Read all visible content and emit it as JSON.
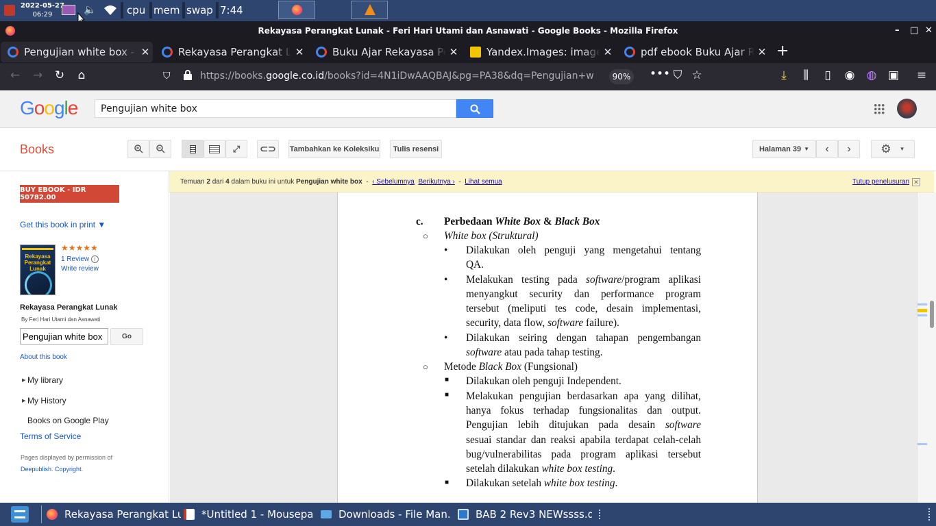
{
  "top_panel": {
    "date": "2022-05-27",
    "time_small": "06:29",
    "cpu": "cpu",
    "mem": "mem",
    "swap": "swap",
    "clock": "7:44"
  },
  "window": {
    "title": "Rekayasa Perangkat Lunak - Feri Hari Utami dan Asnawati - Google Books - Mozilla Firefox"
  },
  "tabs": [
    {
      "label": "Pengujian white box - P",
      "active": true
    },
    {
      "label": "Rekayasa Perangkat Lu",
      "active": false
    },
    {
      "label": "Buku Ajar Rekayasa Pe",
      "active": false
    },
    {
      "label": "Yandex.Images: image",
      "active": false
    },
    {
      "label": "pdf ebook Buku Ajar Re",
      "active": false
    }
  ],
  "navbar": {
    "url_prefix": "https://books.",
    "url_domain": "google.co.id",
    "url_rest": "/books?id=4N1iDwAAQBAJ&pg=PA38&dq=Pengujian+w",
    "zoom": "90%"
  },
  "google": {
    "search_value": "Pengujian white box"
  },
  "books_bar": {
    "books_label": "Books",
    "add_collection": "Tambahkan ke Koleksiku",
    "write_review": "Tulis resensi",
    "page_select": "Halaman 39"
  },
  "sidebar": {
    "buy_label": "BUY EBOOK - IDR 50782.00",
    "get_print": "Get this book in print ▼",
    "stars": "★★★★★",
    "reviews": "1 Review",
    "write_review": "Write review",
    "cover_title": "Rekayasa Perangkat Lunak",
    "book_title": "Rekayasa Perangkat Lunak",
    "authors": "By Feri Hari Utami dan Asnawati",
    "search_value": "Pengujian white box",
    "go": "Go",
    "about": "About this book",
    "my_library": "My library",
    "my_history": "My History",
    "books_on_play": "Books on Google Play",
    "terms": "Terms of Service",
    "perm_text": "Pages displayed by permission of",
    "publisher": "Deepublish",
    "copyright": "Copyright"
  },
  "notice": {
    "t1": "Temuan",
    "n": "2",
    "t2": "dari",
    "total": "4",
    "t3": "dalam buku ini untuk",
    "query": "Pengujian white box",
    "prev": "‹ Sebelumnya",
    "next": "Berikutnya ›",
    "all": "Lihat semua",
    "close": "Tutup penelusuran"
  },
  "page_content": {
    "heading_num": "c.",
    "heading_a": "Perbedaan ",
    "heading_b": "White Box",
    "heading_c": " & ",
    "heading_d": "Black Box",
    "sub1_a": "White box",
    "sub1_b": " (Struktural)",
    "l1a": "Dilakukan oleh penguji yang mengetahui tentang",
    "l1b": "QA.",
    "l2a_1": "Melakukan testing pada ",
    "l2a_2": "software",
    "l2a_3": "/program aplikasi",
    "l2b": "menyangkut security dan performance program",
    "l2c": "tersebut (meliputi tes code, desain implementasi,",
    "l2d_1": "security, data flow, ",
    "l2d_2": "software",
    "l2d_3": " failure).",
    "l3a": "Dilakukan seiring dengan tahapan pengembangan",
    "l3b_1": "software",
    "l3b_2": " atau pada tahap testing.",
    "sub2_a": "Metode ",
    "sub2_b": "Black Box",
    "sub2_c": " (Fungsional)",
    "m1": "Dilakukan oleh penguji Independent.",
    "m2a": "Melakukan pengujian berdasarkan apa yang dilihat,",
    "m2b": "hanya fokus terhadap fungsionalitas dan output.",
    "m2c_1": "Pengujian lebih ditujukan pada desain ",
    "m2c_2": "software",
    "m2d": "sesuai standar dan reaksi apabila terdapat celah-celah",
    "m2e": "bug/vulnerabilitas pada program aplikasi tersebut",
    "m2f_1": "setelah dilakukan ",
    "m2f_2": "white box testing",
    "m2f_3": ".",
    "m3_1": "Dilakukan setelah ",
    "m3_2": "white box testing",
    "m3_3": "."
  },
  "taskbar": {
    "items": [
      {
        "label": "Rekayasa Perangkat Lu..."
      },
      {
        "label": "*Untitled 1 - Mousepad"
      },
      {
        "label": "Downloads - File Man..."
      },
      {
        "label": "BAB 2 Rev3 NEWssss.d..."
      }
    ]
  }
}
